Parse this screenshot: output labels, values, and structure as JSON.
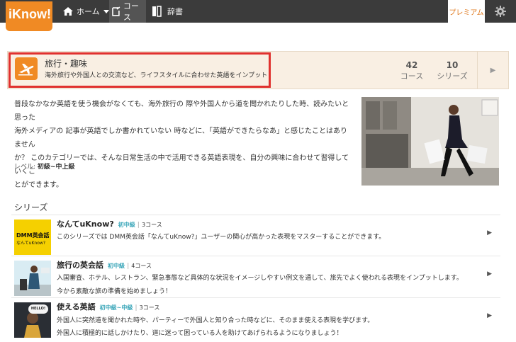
{
  "nav": {
    "logo": "iKnow!",
    "home": "ホーム",
    "course": "コース",
    "dictionary": "辞書",
    "premium": "プレミアム",
    "gear_icon": "gear-icon"
  },
  "category": {
    "title": "旅行・趣味",
    "description": "海外旅行や外国人との交流など、ライフスタイルに合わせた英語をインプット",
    "courses_count": "42",
    "courses_label": "コース",
    "series_count": "10",
    "series_label": "シリーズ",
    "arrow": "▶"
  },
  "intro": {
    "line1": "普段なかなか英語を使う機会がなくても、海外旅行の 際や外国人から道を聞かれたりした時、読みたいと思った",
    "line2": "海外メディアの 記事が英語でしか書かれていない 時などに、「英語ができたらなあ」と感じたことはありません",
    "line3": "か？ このカテゴリーでは、そんな日常生活の中で活用できる英語表現を、自分の興味に合わせて習得していくこ",
    "line4": "とができます。",
    "level_label": "レベル:",
    "level_value": "初級~中上級"
  },
  "series": {
    "heading": "シリーズ",
    "items": [
      {
        "title": "なんてuKnow?",
        "level": "初中級",
        "count": "3コース",
        "desc1": "このシリーズでは DMM英会話「なんてuKnow?」ユーザーの関心が高かった表現をマスターすることができます。",
        "desc2": "",
        "thumb_line1": "DMM英会話",
        "thumb_line2": "なんてuKnow?"
      },
      {
        "title": "旅行の英会話",
        "level": "初中級",
        "count": "4コース",
        "desc1": "入国審査、ホテル、レストラン、緊急事態など具体的な状況をイメージしやすい例文を通して、旅先でよく使われる表現をインプットします。",
        "desc2": "今から素敵な旅の準備を始めましょう！"
      },
      {
        "title": "使える英語",
        "level": "初中級~中級",
        "count": "3コース",
        "desc1": "外国人に突然道を聞かれた時や、パーティーで外国人と知り合った時などに、そのまま使える表現を学びます。",
        "desc2": "外国人に積極的に話しかけたり、道に迷って困っている人を助けてあげられるようになりましょう！",
        "thumb_text": "HELLO!"
      }
    ],
    "arrow": "▶"
  }
}
